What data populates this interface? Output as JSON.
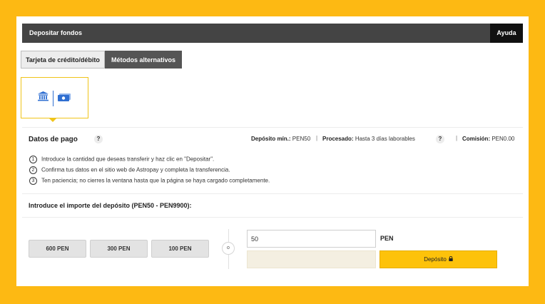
{
  "header": {
    "title": "Depositar fondos",
    "help_label": "Ayuda"
  },
  "tabs": [
    {
      "label": "Tarjeta de crédito/débito",
      "active": false
    },
    {
      "label": "Métodos alternativos",
      "active": true
    }
  ],
  "payment_methods": {
    "icons": [
      "bank-icon",
      "cash-icon"
    ],
    "accent": "#2f6fd1"
  },
  "payment_info": {
    "title": "Datos de pago",
    "help": "?",
    "min_deposit_label": "Depósito mín.:",
    "min_deposit_value": "PEN50",
    "separator": "|",
    "processed_label": "Procesado:",
    "processed_value": "Hasta 3 días laborables",
    "commission_label": "Comisión:",
    "commission_value": "PEN0.00"
  },
  "steps": [
    {
      "num": "1",
      "text": "Introduce la cantidad que deseas transferir y haz clic en \"Depositar\"."
    },
    {
      "num": "2",
      "text": "Confirma tus datos en el sitio web de Astropay y completa la transferencia."
    },
    {
      "num": "3",
      "text": "Ten paciencia; no cierres la ventana hasta que la página se haya cargado completamente."
    }
  ],
  "amount": {
    "title": "Introduce el importe del depósito (PEN50 - PEN9900):",
    "presets": [
      "600 PEN",
      "300 PEN",
      "100 PEN"
    ],
    "or_label": "o",
    "value": "50",
    "currency": "PEN",
    "deposit_label": "Depósito"
  },
  "colors": {
    "background": "#FDB913",
    "header": "#444444",
    "button": "#FDC20A"
  }
}
